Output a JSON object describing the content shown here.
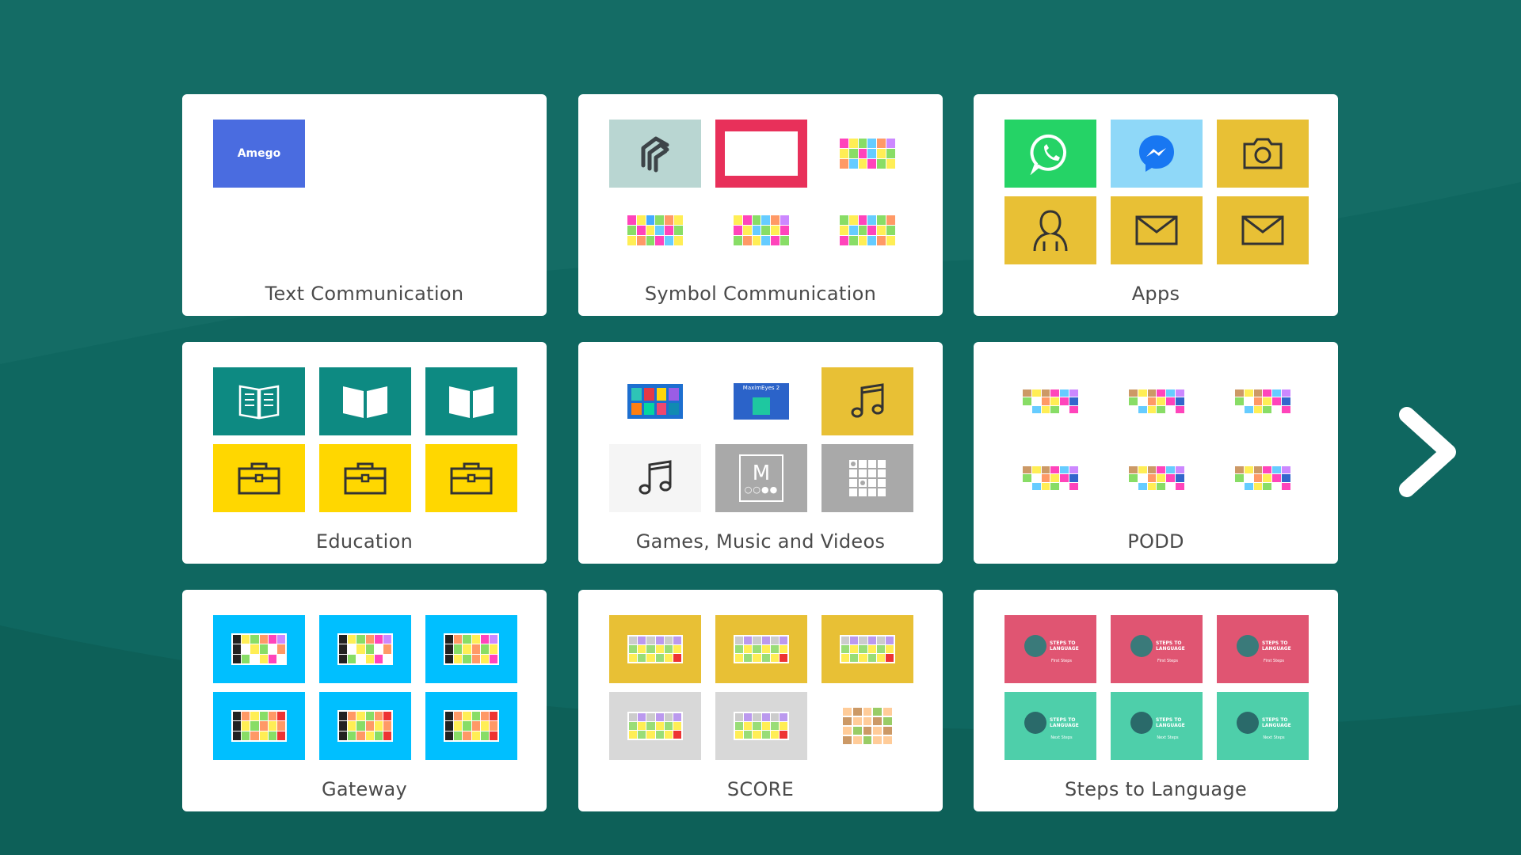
{
  "colors": {
    "background": "#136a63",
    "card": "#ffffff",
    "label": "#4a4a4a"
  },
  "categories": [
    {
      "label": "Text Communication"
    },
    {
      "label": "Symbol Communication"
    },
    {
      "label": "Apps"
    },
    {
      "label": "Education"
    },
    {
      "label": "Games, Music and Videos"
    },
    {
      "label": "PODD"
    },
    {
      "label": "Gateway"
    },
    {
      "label": "SCORE"
    },
    {
      "label": "Steps to Language"
    }
  ],
  "tiles": {
    "text_communication": {
      "amego_logo": "Amego"
    },
    "apps": [
      "whatsapp-icon",
      "messenger-icon",
      "camera-icon",
      "person-icon",
      "mail-icon",
      "mail-icon"
    ],
    "education": [
      "open-book-icon",
      "book-icon",
      "book-icon",
      "briefcase-icon",
      "briefcase-icon",
      "briefcase-icon"
    ],
    "games_music_videos": {
      "maximeyes_label": "MaximEyes 2",
      "m_tile_letter": "M"
    },
    "steps_to_language": {
      "logo_text": "STEPS TO LANGUAGE",
      "first_steps": "First Steps",
      "next_steps": "Next Steps"
    }
  },
  "navigation": {
    "next_icon": "chevron-right-icon"
  }
}
